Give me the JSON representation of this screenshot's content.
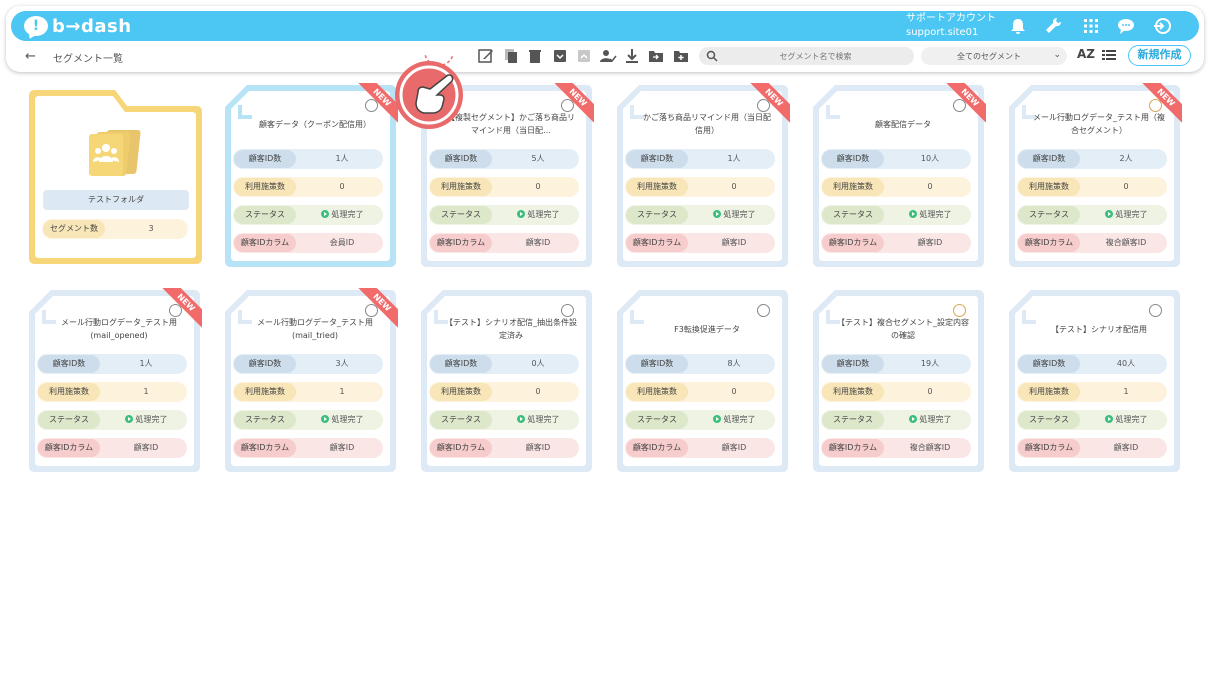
{
  "header": {
    "logo_text": "b→dash",
    "account_name": "サポートアカウント",
    "account_id": "support.site01"
  },
  "toolbar": {
    "back_label": "←",
    "breadcrumb": "セグメント一覧",
    "search_placeholder": "セグメント名で検索",
    "filter_value": "全てのセグメント",
    "sort_label": "AZ",
    "new_button": "新規作成"
  },
  "labels": {
    "customer_id_count": "顧客ID数",
    "usage_count": "利用施策数",
    "status": "ステータス",
    "customer_id_column": "顧客IDカラム",
    "segment_count": "セグメント数",
    "new_badge": "NEW"
  },
  "folder": {
    "name": "テストフォルダ",
    "segment_count": "3"
  },
  "cards": [
    {
      "title": "顧客データ（クーポン配信用）",
      "count": "1人",
      "usage": "0",
      "status": "処理完了",
      "column": "会員ID",
      "new": true
    },
    {
      "title": "【複製セグメント】かご落ち商品リマインド用（当日配…",
      "count": "5人",
      "usage": "0",
      "status": "処理完了",
      "column": "顧客ID",
      "new": true
    },
    {
      "title": "かご落ち商品リマインド用（当日配信用）",
      "count": "1人",
      "usage": "0",
      "status": "処理完了",
      "column": "顧客ID",
      "new": true
    },
    {
      "title": "顧客配信データ",
      "count": "10人",
      "usage": "0",
      "status": "処理完了",
      "column": "顧客ID",
      "new": true
    },
    {
      "title": "メール行動ログデータ_テスト用（複合セグメント）",
      "count": "2人",
      "usage": "0",
      "status": "処理完了",
      "column": "複合顧客ID",
      "new": true
    },
    {
      "title": "メール行動ログデータ_テスト用(mail_opened)",
      "count": "1人",
      "usage": "1",
      "status": "処理完了",
      "column": "顧客ID",
      "new": true
    },
    {
      "title": "メール行動ログデータ_テスト用(mail_tried)",
      "count": "3人",
      "usage": "1",
      "status": "処理完了",
      "column": "顧客ID",
      "new": true
    },
    {
      "title": "【テスト】シナリオ配信_抽出条件設定済み",
      "count": "0人",
      "usage": "0",
      "status": "処理完了",
      "column": "顧客ID",
      "new": false
    },
    {
      "title": "F3転換促進データ",
      "count": "8人",
      "usage": "0",
      "status": "処理完了",
      "column": "顧客ID",
      "new": false
    },
    {
      "title": "【テスト】複合セグメント_設定内容の確認",
      "count": "19人",
      "usage": "0",
      "status": "処理完了",
      "column": "複合顧客ID",
      "new": false
    },
    {
      "title": "【テスト】シナリオ配信用",
      "count": "40人",
      "usage": "1",
      "status": "処理完了",
      "column": "顧客ID",
      "new": false
    }
  ],
  "colors": {
    "accent": "#4cc6f2",
    "new_badge": "#f16b6b",
    "folder": "#f7d67a",
    "highlight": "#e86a6a"
  }
}
